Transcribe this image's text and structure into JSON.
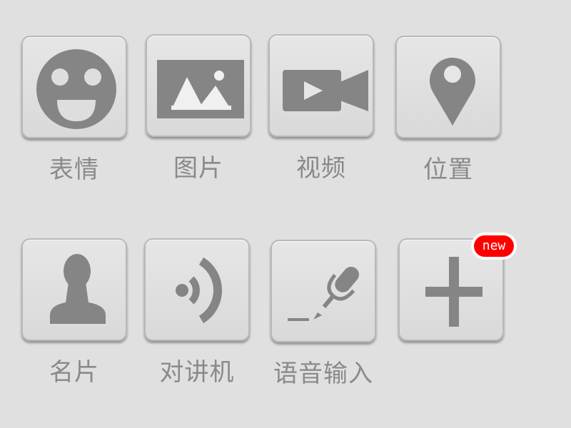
{
  "panel": {
    "items": [
      {
        "label": "表情",
        "icon": "smiley-icon"
      },
      {
        "label": "图片",
        "icon": "picture-icon"
      },
      {
        "label": "视频",
        "icon": "video-camera-icon"
      },
      {
        "label": "位置",
        "icon": "location-pin-icon"
      },
      {
        "label": "名片",
        "icon": "contact-card-icon"
      },
      {
        "label": "对讲机",
        "icon": "walkie-talkie-icon"
      },
      {
        "label": "语音输入",
        "icon": "voice-input-icon"
      },
      {
        "label": "",
        "icon": "plus-icon",
        "badge": "new"
      }
    ]
  },
  "colors": {
    "background": "#e0e0e0",
    "icon": "#858585",
    "label": "#8a8a8a",
    "badge": "#ff0000"
  }
}
